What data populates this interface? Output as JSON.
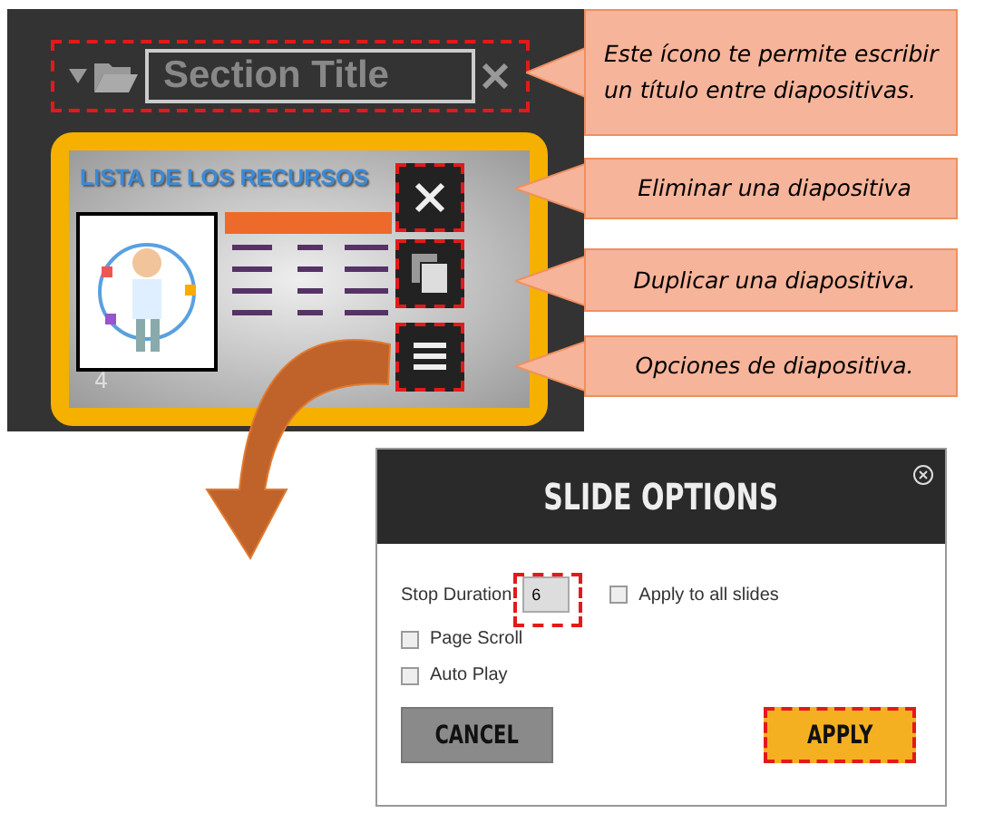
{
  "panel": {
    "section_title": "Section Title",
    "slide": {
      "title": "LISTA DE LOS RECURSOS",
      "number": "4"
    },
    "slide_buttons": [
      {
        "kind": "delete"
      },
      {
        "kind": "duplicate"
      },
      {
        "kind": "options"
      }
    ]
  },
  "callouts": [
    {
      "text": "Este ícono te permite escribir un título entre diapositivas."
    },
    {
      "text": "Eliminar una diapositiva"
    },
    {
      "text": "Duplicar una diapositiva."
    },
    {
      "text": "Opciones de diapositiva."
    }
  ],
  "dialog": {
    "title": "SLIDE OPTIONS",
    "stop_duration": {
      "label": "Stop Duration",
      "value": "6"
    },
    "options": [
      {
        "label": "Apply to all slides",
        "checked": false
      },
      {
        "label": "Page Scroll",
        "checked": false
      },
      {
        "label": "Auto Play",
        "checked": false
      }
    ],
    "buttons": [
      {
        "label": "CANCEL",
        "kind": "secondary"
      },
      {
        "label": "APPLY",
        "kind": "primary"
      }
    ]
  }
}
